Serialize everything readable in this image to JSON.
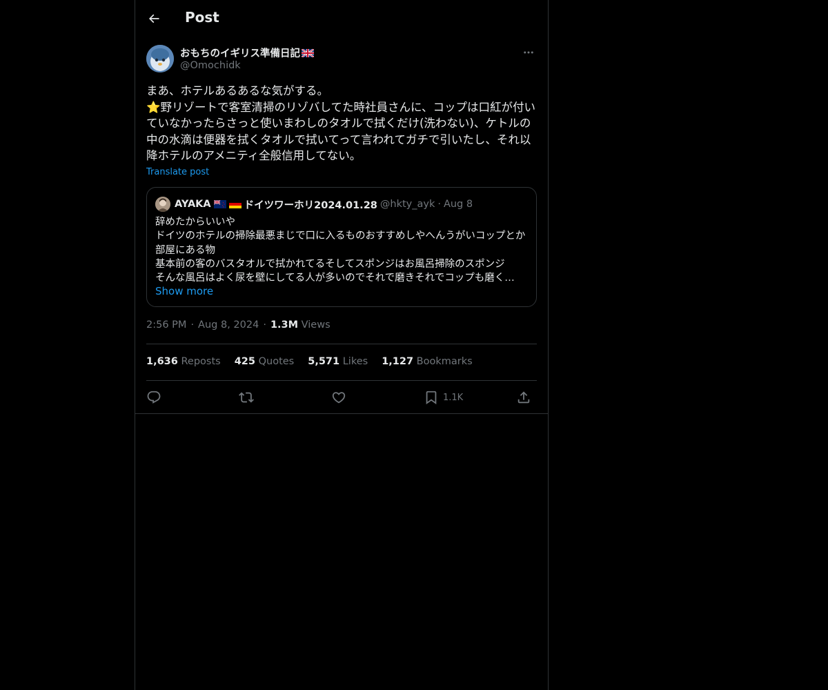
{
  "header": {
    "title": "Post"
  },
  "post": {
    "author_name": "おもちのイギリス準備日記",
    "author_handle": "@Omochidk",
    "text": "まあ、ホテルあるあるな気がする。\n⭐️野リゾートで客室清掃のリゾバしてた時社員さんに、コップは口紅が付いていなかったらさっと使いまわしのタオルで拭くだけ(洗わない)、ケトルの中の水滴は便器を拭くタオルで拭いてって言われてガチで引いたし、それ以降ホテルのアメニティ全般信用してない。",
    "translate_label": "Translate post",
    "time": "2:56 PM",
    "date": "Aug 8, 2024",
    "views_count": "1.3M",
    "views_label": "Views"
  },
  "quote": {
    "name": "AYAKA",
    "name_suffix": "ドイツワーホリ2024.01.28",
    "handle": "@hkty_ayk",
    "date": "Aug 8",
    "text": "辞めたからいいや\nドイツのホテルの掃除最悪まじで口に入るものおすすめしやへんうがいコップとか部屋にある物\n基本前の客のバスタオルで拭かれてるそしてスポンジはお風呂掃除のスポンジ\nそんな風呂はよく尿を壁にしてる人が多いのでそれで磨きそれでコップも磨く…",
    "show_more": "Show more"
  },
  "stats": {
    "reposts": {
      "count": "1,636",
      "label": "Reposts"
    },
    "quotes": {
      "count": "425",
      "label": "Quotes"
    },
    "likes": {
      "count": "5,571",
      "label": "Likes"
    },
    "bookmarks": {
      "count": "1,127",
      "label": "Bookmarks"
    }
  },
  "actions": {
    "reply_icon": "reply-icon",
    "repost_icon": "repost-icon",
    "like_icon": "heart-icon",
    "bookmark_icon": "bookmark-icon",
    "bookmark_count": "1.1K",
    "share_icon": "share-icon"
  },
  "colors": {
    "background": "#000000",
    "text": "#e7e9ea",
    "muted": "#71767b",
    "accent": "#1d9bf0",
    "border": "#2f3336"
  }
}
